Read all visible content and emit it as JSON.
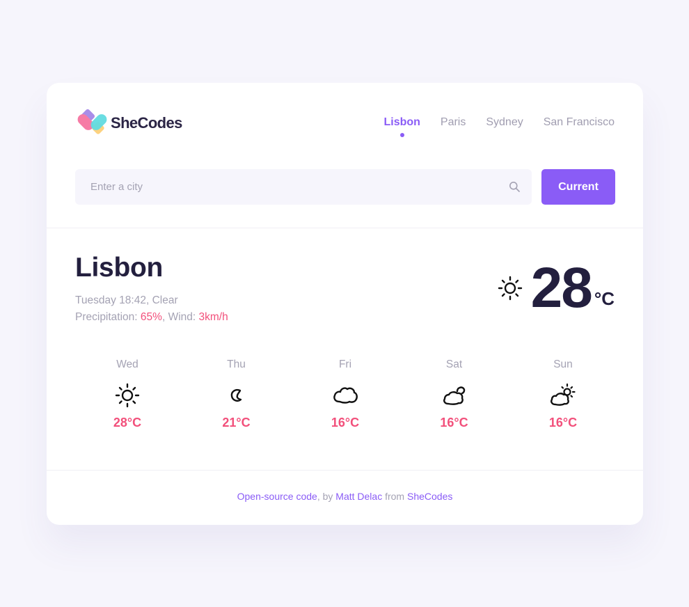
{
  "brand": {
    "name": "SheCodes",
    "colors": {
      "accent": "#8a5cf6",
      "highlight": "#f2507b",
      "text_dark": "#231f3e",
      "muted": "#a4a2b3"
    }
  },
  "nav": {
    "items": [
      {
        "label": "Lisbon",
        "active": true
      },
      {
        "label": "Paris",
        "active": false
      },
      {
        "label": "Sydney",
        "active": false
      },
      {
        "label": "San Francisco",
        "active": false
      }
    ]
  },
  "search": {
    "placeholder": "Enter a city",
    "value": "",
    "icon": "search-icon",
    "current_label": "Current"
  },
  "current": {
    "city": "Lisbon",
    "day_time": "Tuesday 18:42",
    "condition": "Clear",
    "precipitation_label": "Precipitation:",
    "precipitation": "65%",
    "wind_label": "Wind:",
    "wind": "3km/h",
    "icon": "sun-icon",
    "temperature": "28",
    "unit": "°C"
  },
  "forecast": [
    {
      "day": "Wed",
      "icon": "sun-icon",
      "temp": "28°C"
    },
    {
      "day": "Thu",
      "icon": "moon-icon",
      "temp": "21°C"
    },
    {
      "day": "Fri",
      "icon": "cloud-icon",
      "temp": "16°C"
    },
    {
      "day": "Sat",
      "icon": "cloud-moon-icon",
      "temp": "16°C"
    },
    {
      "day": "Sun",
      "icon": "cloud-sun-icon",
      "temp": "16°C"
    }
  ],
  "footer": {
    "code_link": "Open-source code",
    "by_text": ", by ",
    "author_link": "Matt Delac",
    "from_text": " from ",
    "org_link": "SheCodes"
  }
}
